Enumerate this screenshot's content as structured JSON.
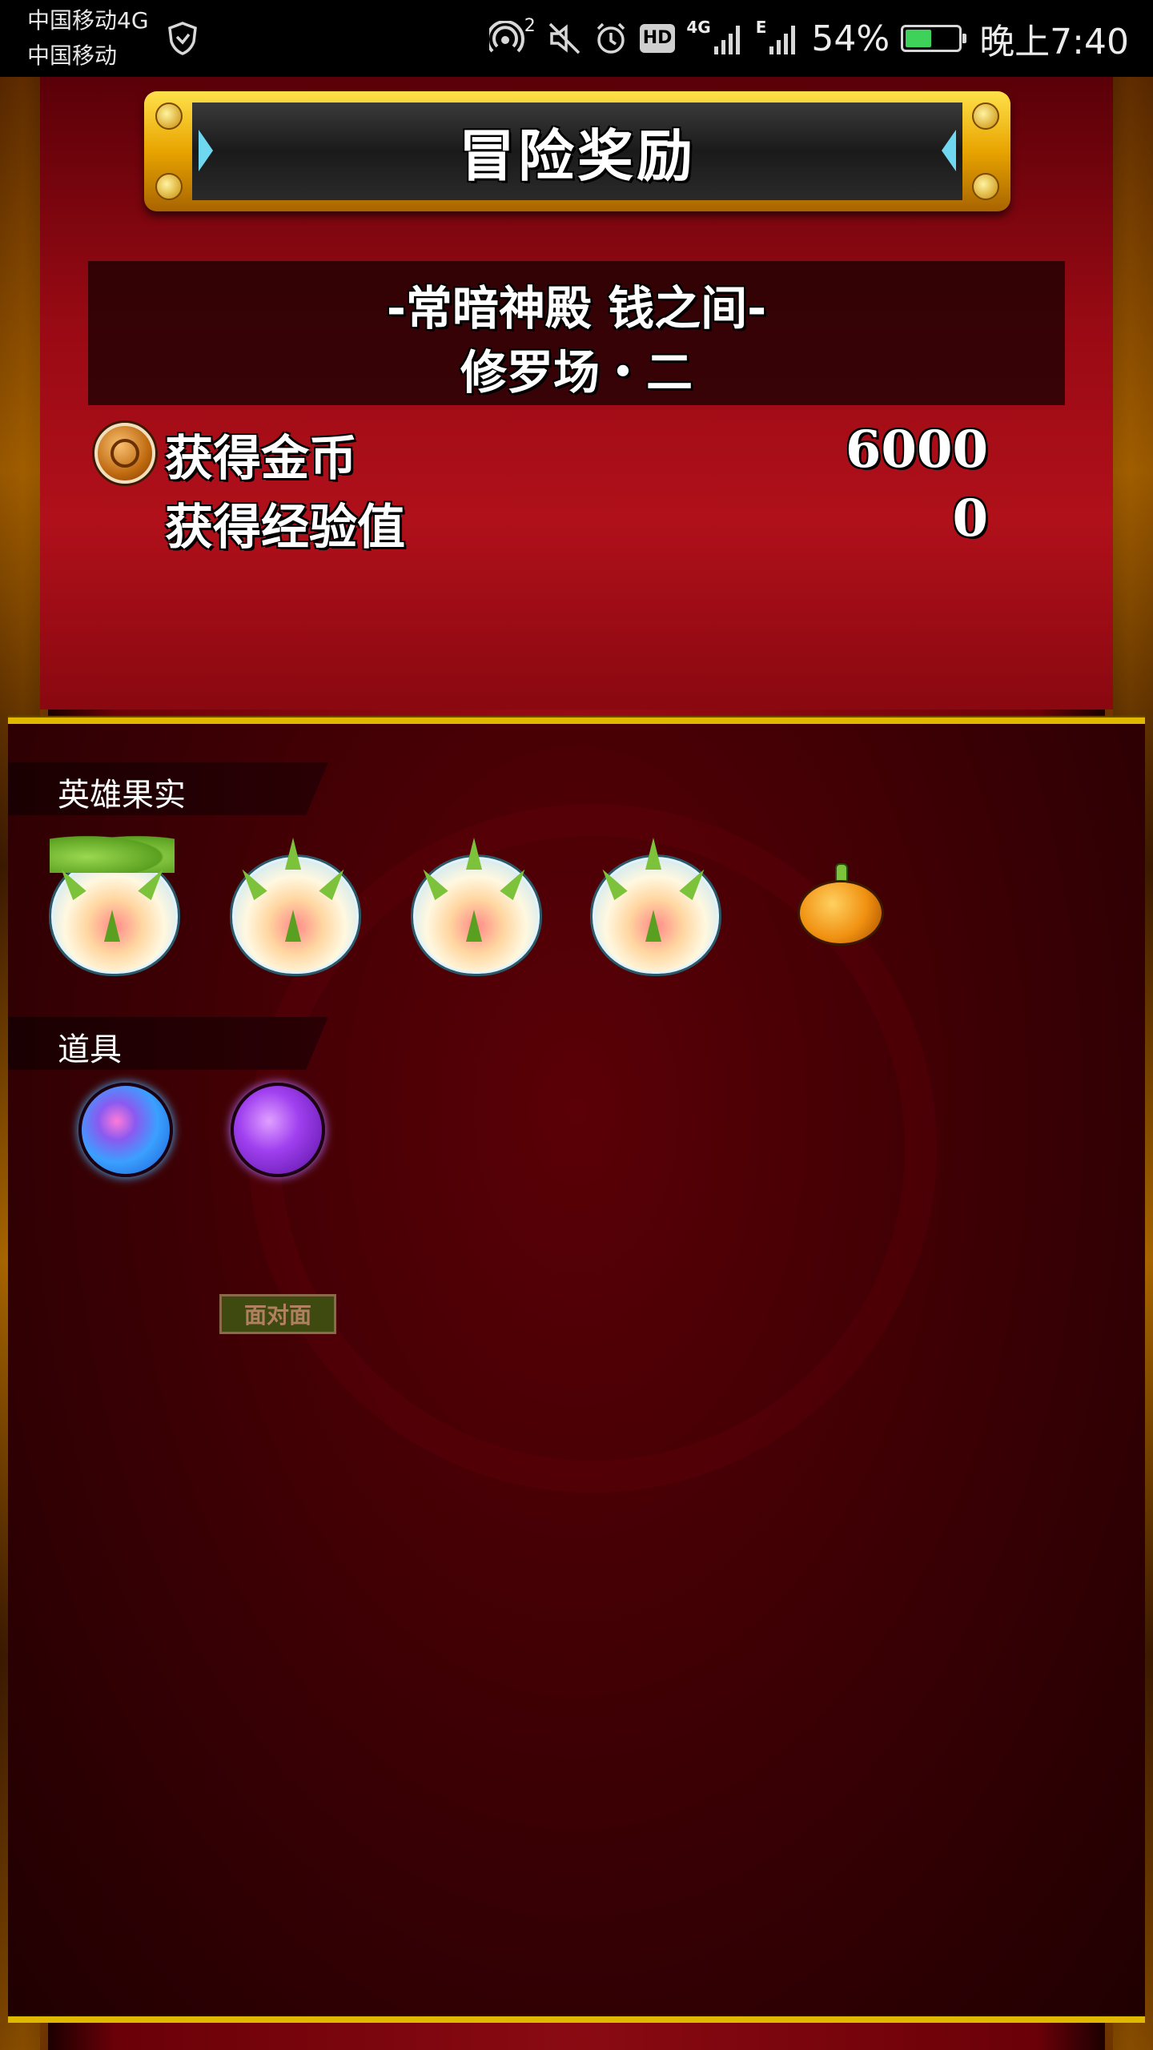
{
  "status_bar": {
    "carrier_1": "中国移动4G",
    "carrier_2": "中国移动",
    "hotspot_count": "2",
    "hd_badge": "HD",
    "network_4g": "4G",
    "network_e": "E",
    "battery_percent_text": "54%",
    "battery_level": 0.54,
    "time": "晚上7:40"
  },
  "title": "冒险奖励",
  "stage": {
    "line1": "-常暗神殿 钱之间-",
    "line2": "修罗场・二"
  },
  "rewards": {
    "gold_label": "获得金币",
    "gold_value": "6000",
    "exp_label": "获得经验值",
    "exp_value": "0"
  },
  "sections": {
    "hero_fruit": {
      "label": "英雄果实",
      "items": [
        "fruit-leafy",
        "fruit-white",
        "fruit-white",
        "fruit-white",
        "pumpkin"
      ]
    },
    "items": {
      "label": "道具",
      "gems": [
        "gem-blue",
        "gem-purple"
      ],
      "gem_tag": "面对面"
    }
  },
  "colors": {
    "background_red": "#8a0a12",
    "panel_dark": "#3a0004",
    "gold_trim": "#e0b800",
    "battery_green": "#3fd25a"
  }
}
